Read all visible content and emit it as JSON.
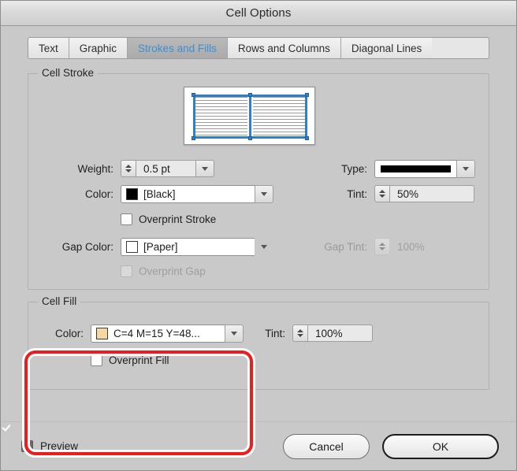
{
  "window": {
    "title": "Cell Options"
  },
  "tabs": [
    {
      "label": "Text",
      "active": false
    },
    {
      "label": "Graphic",
      "active": false
    },
    {
      "label": "Strokes and Fills",
      "active": true
    },
    {
      "label": "Rows and Columns",
      "active": false
    },
    {
      "label": "Diagonal Lines",
      "active": false
    }
  ],
  "cell_stroke": {
    "group_label": "Cell Stroke",
    "weight": {
      "label": "Weight:",
      "value": "0.5 pt"
    },
    "color": {
      "label": "Color:",
      "value": "[Black]",
      "swatch": "#000000"
    },
    "overprint_stroke": {
      "label": "Overprint Stroke",
      "checked": false
    },
    "gap_color": {
      "label": "Gap Color:",
      "value": "[Paper]",
      "swatch": "#ffffff"
    },
    "overprint_gap": {
      "label": "Overprint Gap",
      "checked": false,
      "disabled": true
    },
    "type": {
      "label": "Type:",
      "value": "Solid"
    },
    "tint": {
      "label": "Tint:",
      "value": "50%"
    },
    "gap_tint": {
      "label": "Gap Tint:",
      "value": "100%",
      "disabled": true
    }
  },
  "cell_fill": {
    "group_label": "Cell Fill",
    "color": {
      "label": "Color:",
      "value": "C=4 M=15 Y=48...",
      "swatch": "#f3d8a1"
    },
    "overprint_fill": {
      "label": "Overprint Fill",
      "checked": false
    },
    "tint": {
      "label": "Tint:",
      "value": "100%"
    }
  },
  "footer": {
    "preview": {
      "label": "Preview",
      "checked": true
    },
    "cancel_label": "Cancel",
    "ok_label": "OK"
  },
  "colors": {
    "accent_blue": "#3d8fd6",
    "annotation_red": "#ee1c1c",
    "dialog_bg": "#c9c9c9"
  }
}
